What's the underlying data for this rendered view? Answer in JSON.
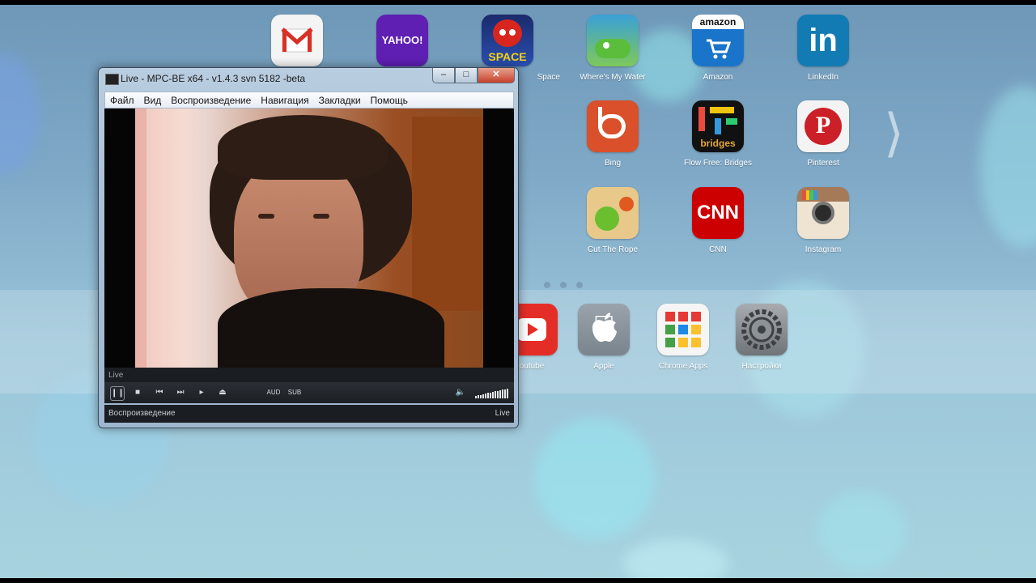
{
  "desktop": {
    "apps_row1": [
      {
        "label": "",
        "icon": "gmail-icon"
      },
      {
        "label": "",
        "icon": "yahoo-icon",
        "logo_text": "YAHOO!"
      },
      {
        "label": "Space",
        "icon": "angry-birds-space-icon",
        "logo_text": "SPACE"
      },
      {
        "label": "Where's My Water",
        "icon": "wheres-my-water-icon"
      },
      {
        "label": "Amazon",
        "icon": "amazon-icon",
        "logo_text": "amazon"
      },
      {
        "label": "LinkedIn",
        "icon": "linkedin-icon",
        "logo_text": "in"
      }
    ],
    "apps_row2": [
      {
        "label": "Bing",
        "icon": "bing-icon"
      },
      {
        "label": "Flow Free: Bridges",
        "icon": "flow-free-bridges-icon",
        "logo_text": "bridges"
      },
      {
        "label": "Pinterest",
        "icon": "pinterest-icon"
      }
    ],
    "apps_row3": [
      {
        "label": "Cut The Rope",
        "icon": "cut-the-rope-icon"
      },
      {
        "label": "CNN",
        "icon": "cnn-icon",
        "logo_text": "CNN"
      },
      {
        "label": "Instagram",
        "icon": "instagram-icon"
      }
    ],
    "dock": [
      {
        "label": "outube",
        "icon": "youtube-icon"
      },
      {
        "label": "Apple",
        "icon": "apple-icon"
      },
      {
        "label": "Chrome Apps",
        "icon": "chrome-apps-icon"
      },
      {
        "label": "Настройки",
        "icon": "settings-gear-icon"
      }
    ],
    "page_count": 3,
    "active_page": 1
  },
  "player": {
    "title": "Live - MPC-BE x64 - v1.4.3 svn 5182 -beta",
    "menu": [
      "Файл",
      "Вид",
      "Воспроизведение",
      "Навигация",
      "Закладки",
      "Помощь"
    ],
    "info_line": "Live",
    "controls": {
      "aud_label": "AUD",
      "sub_label": "SUB"
    },
    "volume_level": 1.0,
    "status_left": "Воспроизведение",
    "status_right": "Live"
  },
  "colors": {
    "close_button": "#c7412b",
    "player_chrome": "#1c1f23"
  }
}
